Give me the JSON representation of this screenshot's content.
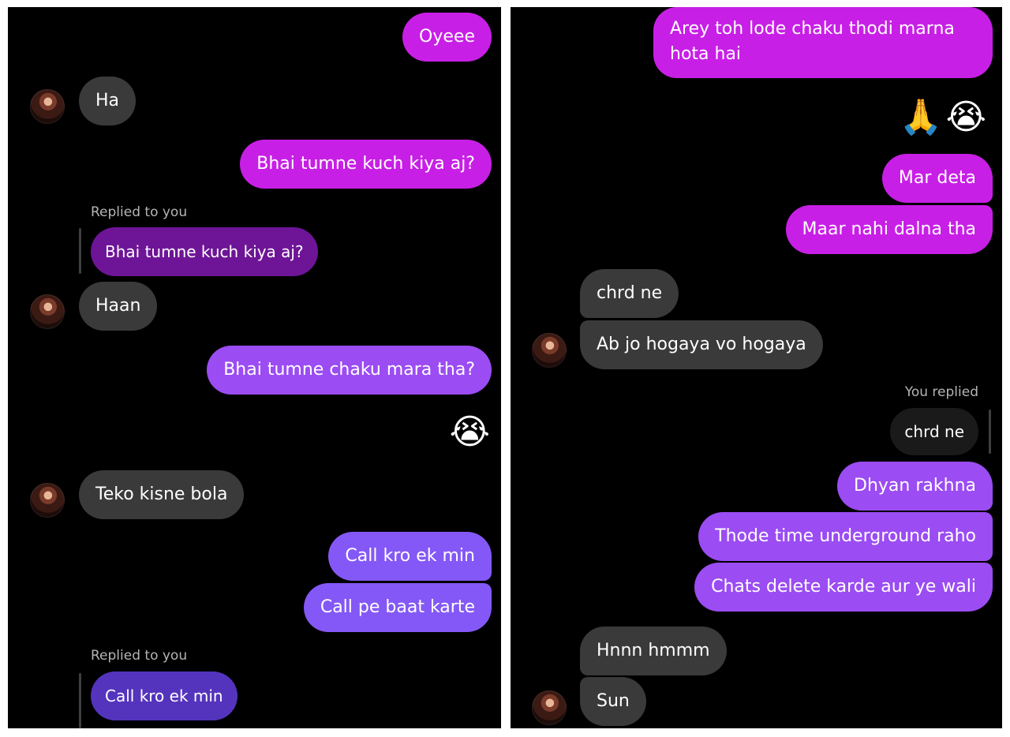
{
  "colors": {
    "background": "#000000",
    "incoming_bubble": "#3a3a3a",
    "outgoing_magenta": "#c81fe6",
    "outgoing_purple": "#9b4cf2",
    "outgoing_violet": "#8458f6",
    "quoted_purple": "#6e1597",
    "quoted_indigo": "#5434bd",
    "quoted_dark": "#1a1a1a",
    "meta_text": "#b5b5b5"
  },
  "left_panel": {
    "messages": [
      {
        "id": "m1",
        "text": "Oyeee"
      },
      {
        "id": "m2",
        "text": "Ha"
      },
      {
        "id": "m3",
        "text": "Bhai tumne kuch kiya aj?"
      },
      {
        "id": "m4",
        "reply_label": "Replied to you",
        "quoted": "Bhai tumne kuch kiya aj?"
      },
      {
        "id": "m5",
        "text": "Haan"
      },
      {
        "id": "m6",
        "text": "Bhai tumne chaku mara tha?"
      },
      {
        "id": "m7",
        "emoji": "😭",
        "emoji_name": "loudly-crying-face-icon"
      },
      {
        "id": "m8",
        "text": "Teko kisne bola"
      },
      {
        "id": "m9",
        "text": "Call kro ek min"
      },
      {
        "id": "m10",
        "text": "Call pe baat karte"
      },
      {
        "id": "m11",
        "reply_label": "Replied to you",
        "quoted": "Call kro ek min"
      }
    ]
  },
  "right_panel": {
    "messages": [
      {
        "id": "r1",
        "text": "Arey toh lode chaku thodi marna hota hai"
      },
      {
        "id": "r2",
        "emoji": "🙏😭",
        "emoji_name": "folded-hands-and-crying-face-icon"
      },
      {
        "id": "r3",
        "text": "Mar deta"
      },
      {
        "id": "r4",
        "text": "Maar nahi dalna tha"
      },
      {
        "id": "r5",
        "text": "chrd ne"
      },
      {
        "id": "r6",
        "text": "Ab jo hogaya vo hogaya"
      },
      {
        "id": "r7",
        "reply_label": "You replied",
        "quoted": "chrd ne"
      },
      {
        "id": "r8",
        "text": "Dhyan rakhna"
      },
      {
        "id": "r9",
        "text": "Thode time underground raho"
      },
      {
        "id": "r10",
        "text": "Chats delete karde aur ye wali"
      },
      {
        "id": "r11",
        "text": "Hnnn hmmm"
      },
      {
        "id": "r12",
        "text": "Sun"
      }
    ]
  }
}
